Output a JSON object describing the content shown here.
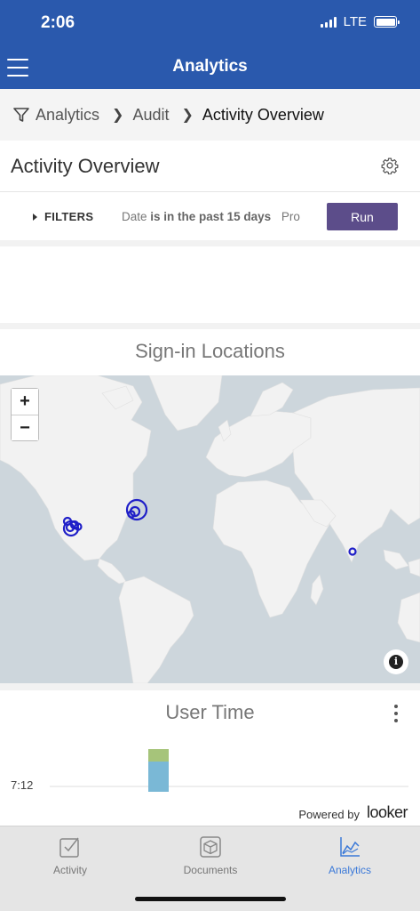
{
  "status": {
    "time": "2:06",
    "network": "LTE"
  },
  "header": {
    "title": "Analytics"
  },
  "breadcrumb": {
    "items": [
      "Analytics",
      "Audit",
      "Activity Overview"
    ]
  },
  "dashboard": {
    "title": "Activity Overview"
  },
  "filters": {
    "toggle_label": "FILTERS",
    "summary_field": "Date",
    "summary_condition": "is in the past 15 days",
    "summary_more": "Pro",
    "run_label": "Run"
  },
  "map_tile": {
    "title": "Sign-in Locations",
    "zoom_in": "+",
    "zoom_out": "−",
    "info": "i",
    "colors": {
      "water": "#cdd6dc",
      "land": "#f2f2f2",
      "marker": "#1f1fc8"
    }
  },
  "user_time_tile": {
    "title": "User Time",
    "chart_data": {
      "type": "bar",
      "title": "User Time",
      "y_ticks": [
        "7:12"
      ],
      "series": [
        {
          "color": "#7ab8d6",
          "values": [
            1
          ]
        },
        {
          "color": "#a6c47a",
          "values": [
            1
          ]
        }
      ]
    }
  },
  "footer": {
    "powered_by": "Powered by",
    "brand": "looker"
  },
  "tabbar": {
    "tabs": [
      {
        "label": "Activity"
      },
      {
        "label": "Documents"
      },
      {
        "label": "Analytics"
      }
    ],
    "active_color": "#3b79d8"
  }
}
